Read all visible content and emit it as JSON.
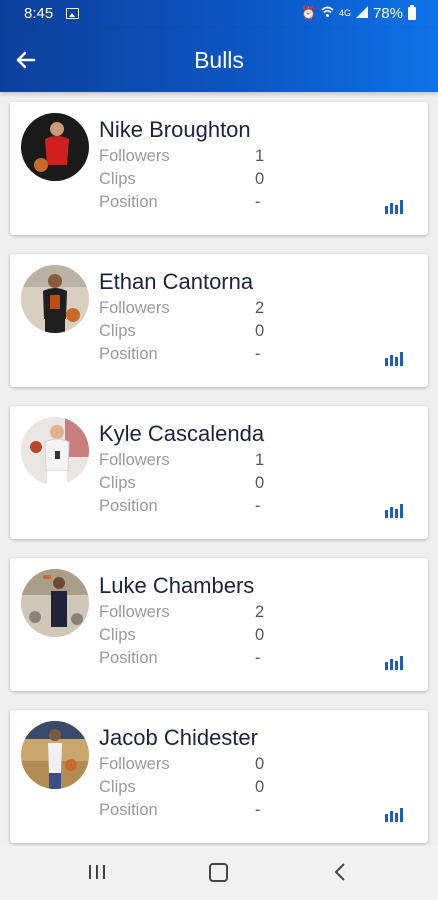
{
  "status_bar": {
    "time": "8:45",
    "battery": "78%",
    "network": "4G"
  },
  "header": {
    "title": "Bulls",
    "back_icon": "arrow-left-icon"
  },
  "stat_labels": {
    "followers": "Followers",
    "clips": "Clips",
    "position": "Position"
  },
  "players": [
    {
      "name": "Nike Broughton",
      "followers": "1",
      "clips": "0",
      "position": "-",
      "jersey_color": "#d11f1f"
    },
    {
      "name": "Ethan Cantorna",
      "followers": "2",
      "clips": "0",
      "position": "-",
      "jersey_color": "#1f1f1f"
    },
    {
      "name": "Kyle Cascalenda",
      "followers": "1",
      "clips": "0",
      "position": "-",
      "jersey_color": "#f4f4f4"
    },
    {
      "name": "Luke Chambers",
      "followers": "2",
      "clips": "0",
      "position": "-",
      "jersey_color": "#20243a"
    },
    {
      "name": "Jacob Chidester",
      "followers": "0",
      "clips": "0",
      "position": "-",
      "jersey_color": "#f0f0f0"
    }
  ],
  "colors": {
    "header_start": "#0b3f9a",
    "header_end": "#0d73e8",
    "accent": "#1d5fb8",
    "name_text": "#1c2340",
    "label_text": "#9a9a9a"
  },
  "nav_bar": {
    "recents_icon": "recents-icon",
    "home_icon": "home-icon",
    "back_icon": "back-chevron-icon"
  }
}
